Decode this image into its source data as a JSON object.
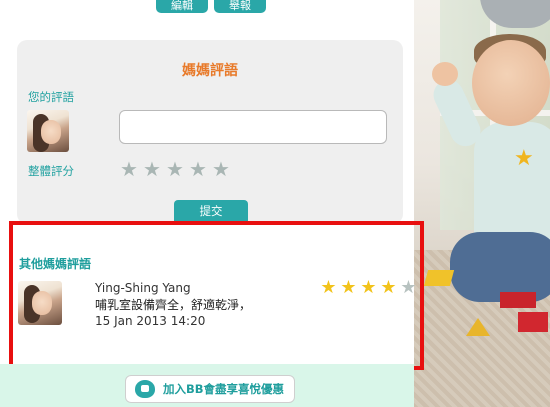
{
  "top_buttons": {
    "edit": "編輯",
    "report": "舉報"
  },
  "review_form": {
    "title": "媽媽評語",
    "your_comment_label": "您的評語",
    "overall_rating_label": "整體評分",
    "rating_value": 0,
    "rating_max": 5,
    "submit": "提交"
  },
  "other_reviews": {
    "title": "其他媽媽評語",
    "items": [
      {
        "name": "Ying-Shing Yang",
        "comment": "哺乳室設備齊全，舒適乾淨，",
        "date": "15 Jan 2013 14:20",
        "rating": 4,
        "rating_max": 5
      }
    ]
  },
  "footer": {
    "join_button": "加入BB會盡享喜悅優惠"
  },
  "colors": {
    "accent": "#2aa7a8",
    "title_orange": "#e87a2a",
    "star_on": "#f2c31b",
    "star_off": "#b7c2c0",
    "highlight_red": "#e80f0f"
  },
  "icons": {
    "star": "star-icon",
    "heart": "heart-icon"
  }
}
